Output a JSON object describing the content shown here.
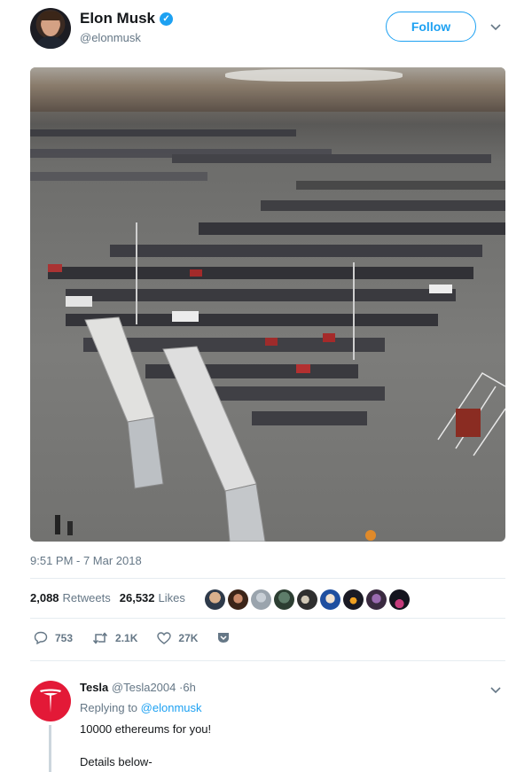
{
  "tweet": {
    "display_name": "Elon Musk",
    "handle": "@elonmusk",
    "verified_icon": "verified-badge-icon",
    "follow_label": "Follow",
    "photo_alt": "parking-lot-photo",
    "timestamp": "9:51 PM - 7 Mar 2018",
    "retweets_count": "2,088",
    "retweets_label": "Retweets",
    "likes_count": "26,532",
    "likes_label": "Likes",
    "actions": {
      "reply_count": "753",
      "retweet_count": "2.1K",
      "like_count": "27K"
    }
  },
  "reply": {
    "name": "Tesla",
    "handle": "@Tesla2004",
    "time": "6h",
    "separator": "·",
    "replying_prefix": "Replying to",
    "replying_to": "@elonmusk",
    "text_line1": "10000 ethereums for you!",
    "text_line2": "Details below-"
  },
  "colors": {
    "accent": "#1da1f2",
    "tesla_red": "#e31937",
    "muted": "#657786"
  }
}
